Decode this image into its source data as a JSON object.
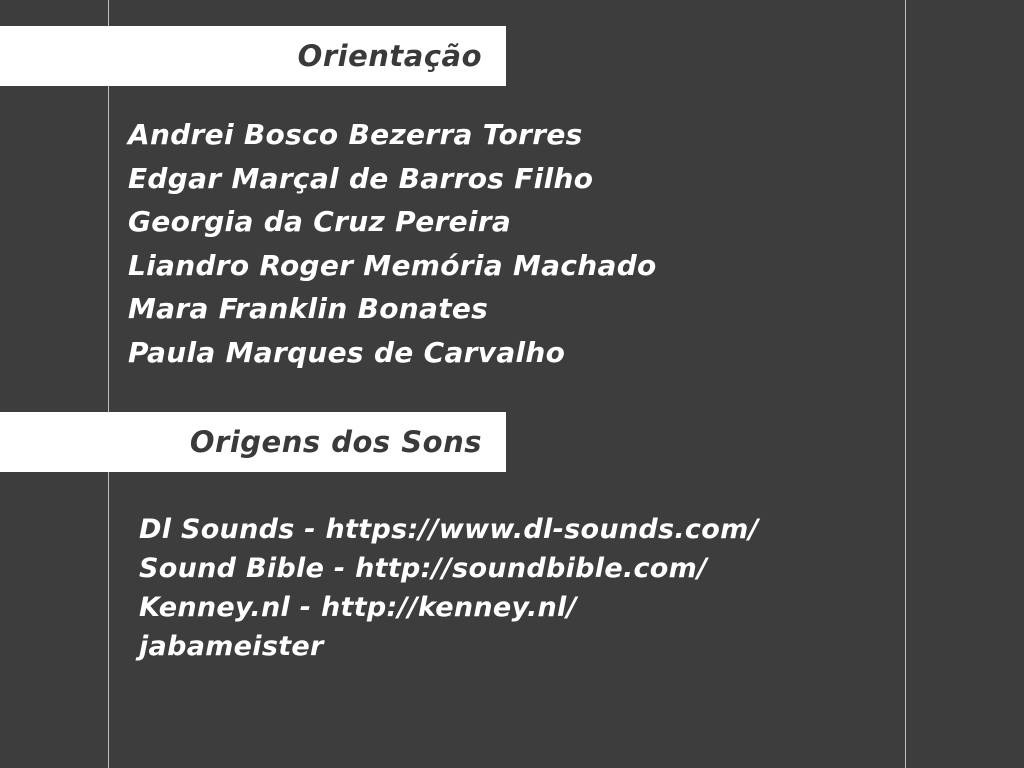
{
  "orientacao": {
    "title": "Orientação",
    "names": [
      "Andrei Bosco Bezerra Torres",
      "Edgar Marçal de Barros Filho",
      "Georgia da Cruz Pereira",
      "Liandro Roger Memória Machado",
      "Mara Franklin Bonates",
      "Paula Marques de Carvalho"
    ]
  },
  "origens": {
    "title": "Origens dos Sons",
    "sources": [
      "Dl Sounds - https://www.dl-sounds.com/",
      "Sound Bible - http://soundbible.com/",
      "Kenney.nl - http://kenney.nl/",
      "jabameister"
    ]
  },
  "colors": {
    "background": "#3d3d3d",
    "banner": "#ffffff",
    "banner_text": "#3a3a3a",
    "text": "#ffffff",
    "rule": "#bfbfbf"
  }
}
